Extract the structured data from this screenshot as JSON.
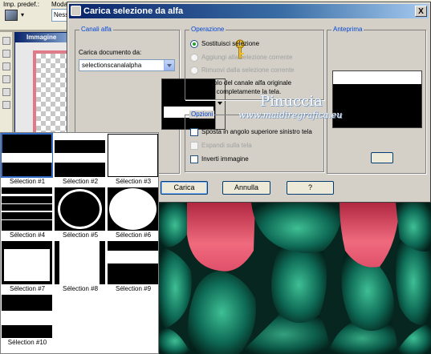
{
  "app": {
    "toolbar": {
      "preset_label": "Imp. predef.:",
      "mode_label": "Modal",
      "mode_value": "Ness"
    },
    "doc_window": {
      "title": "Immagine"
    }
  },
  "dialog": {
    "title": "Carica selezione da alfa",
    "close_label": "X",
    "alpha_channel": {
      "group_title": "Canali alfa",
      "load_from_label": "Carica documento da:",
      "document_value": "selectionscanalalpha"
    },
    "operation": {
      "group_title": "Operazione",
      "options": [
        {
          "label": "Sostituisci selezione",
          "selected": true,
          "enabled": true
        },
        {
          "label": "Aggiungi alla selezione corrente",
          "selected": false,
          "enabled": false
        },
        {
          "label": "Rimuovi dalla selezione corrente",
          "selected": false,
          "enabled": false
        }
      ],
      "info_text_1": "Il rettangolo del canale alfa originale",
      "info_text_2": "interseca completamente la tela."
    },
    "preview": {
      "group_title": "Anteprima"
    },
    "options": {
      "group_title": "Opzioni",
      "checks": [
        {
          "label": "Sposta in angolo superiore sinistro tela",
          "checked": false,
          "enabled": true
        },
        {
          "label": "Espandi sulla tela",
          "checked": false,
          "enabled": false
        },
        {
          "label": "Inverti immagine",
          "checked": false,
          "enabled": true
        }
      ]
    },
    "buttons": {
      "load": "Carica",
      "cancel": "Annulla",
      "help": "?"
    },
    "watermark": {
      "name": "Pinuccia",
      "site": "www.maidiregrafica.eu"
    }
  },
  "selection_palette": {
    "selected_index": 0,
    "items": [
      {
        "label": "Sélection #1"
      },
      {
        "label": "Sélection #2"
      },
      {
        "label": "Sélection #3"
      },
      {
        "label": "Sélection #4"
      },
      {
        "label": "Sélection #5"
      },
      {
        "label": "Sélection #6"
      },
      {
        "label": "Sélection #7"
      },
      {
        "label": "Sélection #8"
      },
      {
        "label": "Sélection #9"
      },
      {
        "label": "Sélection #10"
      }
    ]
  },
  "colors": {
    "accent": "#0046d5",
    "title_bar": "#0a246a",
    "artwork_red": "#e0506a",
    "artwork_teal": "#0e6a55"
  }
}
